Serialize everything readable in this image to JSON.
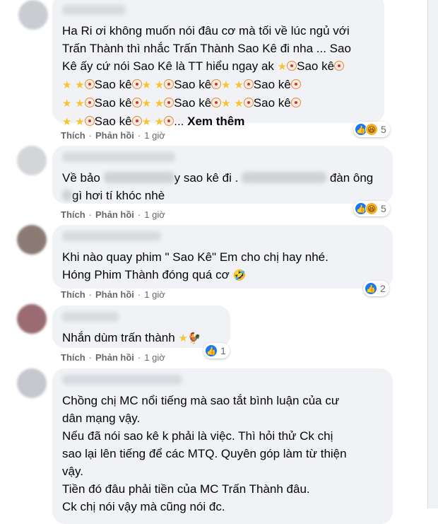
{
  "comments": [
    {
      "lines": [
        "Ha Ri ơi không muốn nói đâu cơ mà tối về lúc ngủ với",
        "Trấn Thành thì nhắc Trấn Thành Sao Kê đi nha ... Sao",
        "Kê ấy cứ nói Sao Kê là TT hiểu ngay ak"
      ],
      "repeat_label": "Sao kê",
      "see_more": "Xem thêm",
      "like": "Thích",
      "reply": "Phản hồi",
      "time": "1 giờ",
      "reaction_count": "5",
      "reaction_icons": [
        "like-icon",
        "haha-icon"
      ]
    },
    {
      "line1_a": "Về bảo",
      "line1_b": "y sao kê đi .",
      "line1_c": "đàn ông",
      "line2": "gì hơi tí khóc nhè",
      "like": "Thích",
      "reply": "Phản hồi",
      "time": "1 giờ",
      "reaction_count": "5",
      "reaction_icons": [
        "like-icon",
        "haha-icon"
      ]
    },
    {
      "line1": "Khi nào quay phim \" Sao Kê\" Em cho chị hay nhé.",
      "line2": "Hóng Phim Thành đóng quá cơ",
      "like": "Thích",
      "reply": "Phản hồi",
      "time": "1 giờ",
      "reaction_count": "2",
      "reaction_icons": [
        "like-icon"
      ]
    },
    {
      "line1": "Nhắn dùm trấn thành",
      "like": "Thích",
      "reply": "Phản hồi",
      "time": "1 giờ",
      "reaction_count": "1",
      "reaction_icons": [
        "like-icon"
      ]
    },
    {
      "lines": [
        "Chồng chị MC nổi tiếng mà sao tắt bình luận của cư",
        "dân mạng vậy.",
        "Nếu đã nói sao kê k phải là việc. Thì hỏi thử Ck chị",
        "sao lại lên tiếng để các MTQ. Quyên góp làm từ thiện",
        "vậy.",
        "Tiền đó đâu phải tiền của MC Trấn Thành đâu.",
        "Ck chị nói vậy mà cũng nói đc."
      ]
    }
  ],
  "dot": "·"
}
